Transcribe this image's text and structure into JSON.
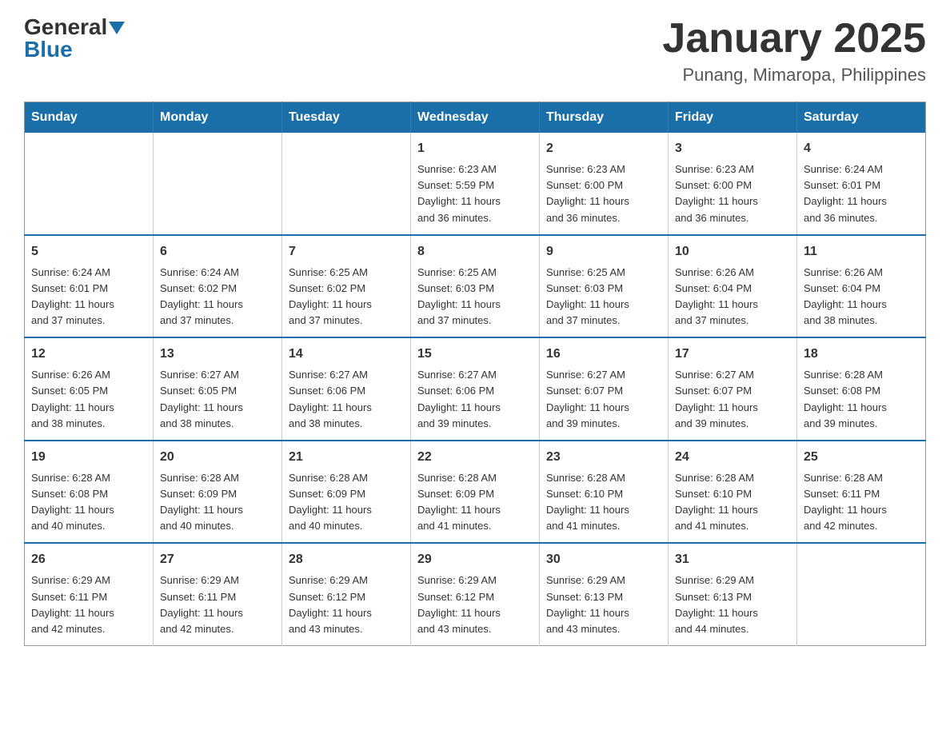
{
  "header": {
    "logo_general": "General",
    "logo_blue": "Blue",
    "month_title": "January 2025",
    "location": "Punang, Mimaropa, Philippines"
  },
  "calendar": {
    "days_of_week": [
      "Sunday",
      "Monday",
      "Tuesday",
      "Wednesday",
      "Thursday",
      "Friday",
      "Saturday"
    ],
    "weeks": [
      [
        {
          "day": "",
          "info": ""
        },
        {
          "day": "",
          "info": ""
        },
        {
          "day": "",
          "info": ""
        },
        {
          "day": "1",
          "info": "Sunrise: 6:23 AM\nSunset: 5:59 PM\nDaylight: 11 hours\nand 36 minutes."
        },
        {
          "day": "2",
          "info": "Sunrise: 6:23 AM\nSunset: 6:00 PM\nDaylight: 11 hours\nand 36 minutes."
        },
        {
          "day": "3",
          "info": "Sunrise: 6:23 AM\nSunset: 6:00 PM\nDaylight: 11 hours\nand 36 minutes."
        },
        {
          "day": "4",
          "info": "Sunrise: 6:24 AM\nSunset: 6:01 PM\nDaylight: 11 hours\nand 36 minutes."
        }
      ],
      [
        {
          "day": "5",
          "info": "Sunrise: 6:24 AM\nSunset: 6:01 PM\nDaylight: 11 hours\nand 37 minutes."
        },
        {
          "day": "6",
          "info": "Sunrise: 6:24 AM\nSunset: 6:02 PM\nDaylight: 11 hours\nand 37 minutes."
        },
        {
          "day": "7",
          "info": "Sunrise: 6:25 AM\nSunset: 6:02 PM\nDaylight: 11 hours\nand 37 minutes."
        },
        {
          "day": "8",
          "info": "Sunrise: 6:25 AM\nSunset: 6:03 PM\nDaylight: 11 hours\nand 37 minutes."
        },
        {
          "day": "9",
          "info": "Sunrise: 6:25 AM\nSunset: 6:03 PM\nDaylight: 11 hours\nand 37 minutes."
        },
        {
          "day": "10",
          "info": "Sunrise: 6:26 AM\nSunset: 6:04 PM\nDaylight: 11 hours\nand 37 minutes."
        },
        {
          "day": "11",
          "info": "Sunrise: 6:26 AM\nSunset: 6:04 PM\nDaylight: 11 hours\nand 38 minutes."
        }
      ],
      [
        {
          "day": "12",
          "info": "Sunrise: 6:26 AM\nSunset: 6:05 PM\nDaylight: 11 hours\nand 38 minutes."
        },
        {
          "day": "13",
          "info": "Sunrise: 6:27 AM\nSunset: 6:05 PM\nDaylight: 11 hours\nand 38 minutes."
        },
        {
          "day": "14",
          "info": "Sunrise: 6:27 AM\nSunset: 6:06 PM\nDaylight: 11 hours\nand 38 minutes."
        },
        {
          "day": "15",
          "info": "Sunrise: 6:27 AM\nSunset: 6:06 PM\nDaylight: 11 hours\nand 39 minutes."
        },
        {
          "day": "16",
          "info": "Sunrise: 6:27 AM\nSunset: 6:07 PM\nDaylight: 11 hours\nand 39 minutes."
        },
        {
          "day": "17",
          "info": "Sunrise: 6:27 AM\nSunset: 6:07 PM\nDaylight: 11 hours\nand 39 minutes."
        },
        {
          "day": "18",
          "info": "Sunrise: 6:28 AM\nSunset: 6:08 PM\nDaylight: 11 hours\nand 39 minutes."
        }
      ],
      [
        {
          "day": "19",
          "info": "Sunrise: 6:28 AM\nSunset: 6:08 PM\nDaylight: 11 hours\nand 40 minutes."
        },
        {
          "day": "20",
          "info": "Sunrise: 6:28 AM\nSunset: 6:09 PM\nDaylight: 11 hours\nand 40 minutes."
        },
        {
          "day": "21",
          "info": "Sunrise: 6:28 AM\nSunset: 6:09 PM\nDaylight: 11 hours\nand 40 minutes."
        },
        {
          "day": "22",
          "info": "Sunrise: 6:28 AM\nSunset: 6:09 PM\nDaylight: 11 hours\nand 41 minutes."
        },
        {
          "day": "23",
          "info": "Sunrise: 6:28 AM\nSunset: 6:10 PM\nDaylight: 11 hours\nand 41 minutes."
        },
        {
          "day": "24",
          "info": "Sunrise: 6:28 AM\nSunset: 6:10 PM\nDaylight: 11 hours\nand 41 minutes."
        },
        {
          "day": "25",
          "info": "Sunrise: 6:28 AM\nSunset: 6:11 PM\nDaylight: 11 hours\nand 42 minutes."
        }
      ],
      [
        {
          "day": "26",
          "info": "Sunrise: 6:29 AM\nSunset: 6:11 PM\nDaylight: 11 hours\nand 42 minutes."
        },
        {
          "day": "27",
          "info": "Sunrise: 6:29 AM\nSunset: 6:11 PM\nDaylight: 11 hours\nand 42 minutes."
        },
        {
          "day": "28",
          "info": "Sunrise: 6:29 AM\nSunset: 6:12 PM\nDaylight: 11 hours\nand 43 minutes."
        },
        {
          "day": "29",
          "info": "Sunrise: 6:29 AM\nSunset: 6:12 PM\nDaylight: 11 hours\nand 43 minutes."
        },
        {
          "day": "30",
          "info": "Sunrise: 6:29 AM\nSunset: 6:13 PM\nDaylight: 11 hours\nand 43 minutes."
        },
        {
          "day": "31",
          "info": "Sunrise: 6:29 AM\nSunset: 6:13 PM\nDaylight: 11 hours\nand 44 minutes."
        },
        {
          "day": "",
          "info": ""
        }
      ]
    ]
  }
}
